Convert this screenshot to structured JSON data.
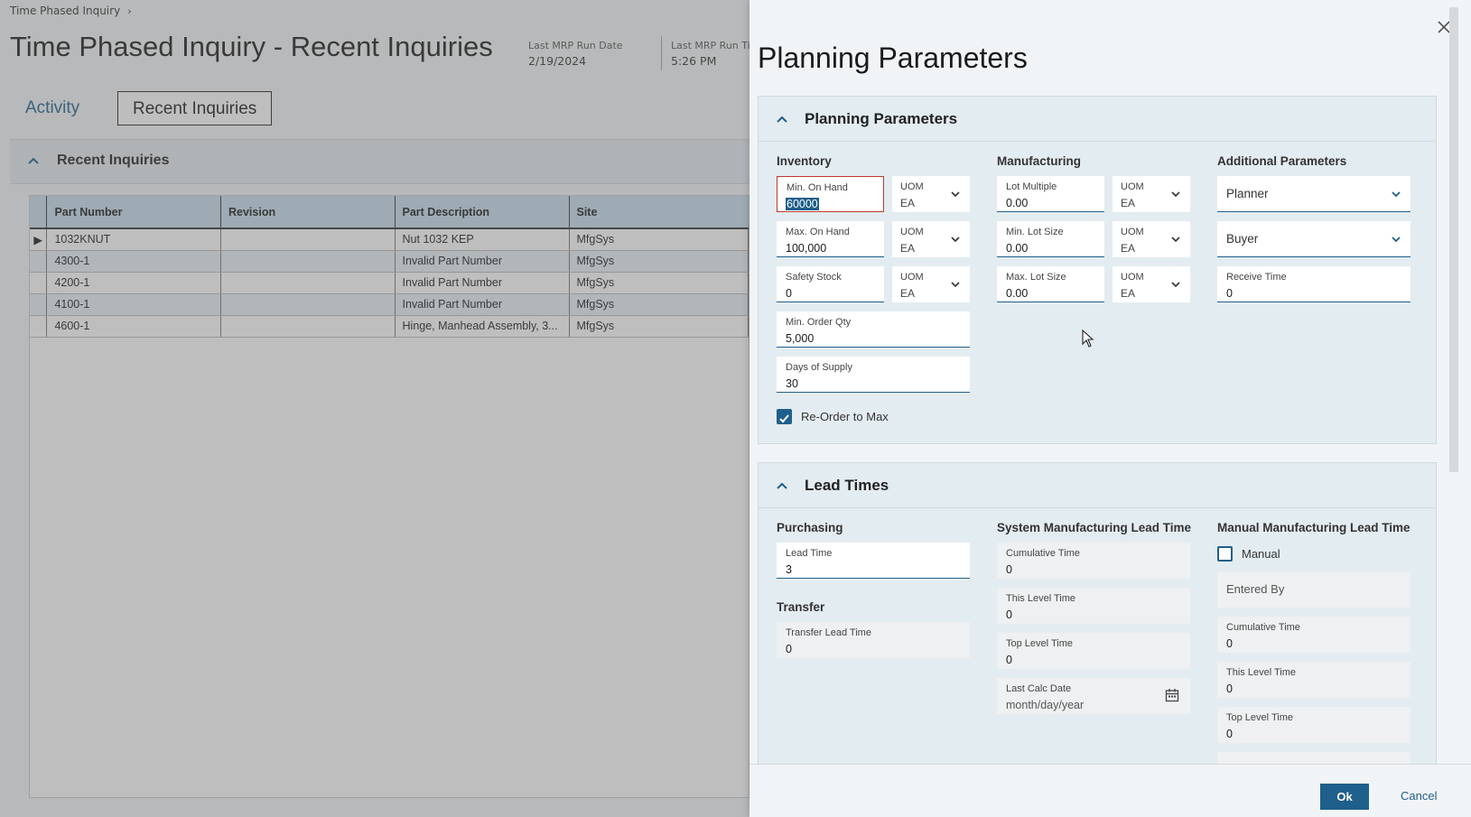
{
  "background": {
    "breadcrumb": "Time Phased Inquiry",
    "title": "Time Phased Inquiry - Recent Inquiries",
    "mrp_run_date_label": "Last MRP Run Date",
    "mrp_run_date": "2/19/2024",
    "mrp_run_time_label": "Last MRP Run Ti",
    "mrp_run_time": "5:26 PM",
    "tabs": [
      "Activity",
      "Recent Inquiries"
    ],
    "section_title": "Recent Inquiries",
    "columns": [
      "Part Number",
      "Revision",
      "Part Description",
      "Site"
    ],
    "rows": [
      {
        "part": "1032KNUT",
        "rev": "",
        "desc": "Nut 1032 KEP",
        "site": "MfgSys"
      },
      {
        "part": "4300-1",
        "rev": "",
        "desc": "Invalid Part Number",
        "site": "MfgSys"
      },
      {
        "part": "4200-1",
        "rev": "",
        "desc": "Invalid Part Number",
        "site": "MfgSys"
      },
      {
        "part": "4100-1",
        "rev": "",
        "desc": "Invalid Part Number",
        "site": "MfgSys"
      },
      {
        "part": "4600-1",
        "rev": "",
        "desc": "Hinge, Manhead Assembly, 3...",
        "site": "MfgSys"
      }
    ]
  },
  "panel": {
    "title": "Planning Parameters",
    "planning": {
      "title": "Planning Parameters",
      "inventory_header": "Inventory",
      "manufacturing_header": "Manufacturing",
      "additional_header": "Additional Parameters",
      "min_on_hand": {
        "label": "Min. On Hand",
        "value": "60000"
      },
      "max_on_hand": {
        "label": "Max. On Hand",
        "value": "100,000"
      },
      "safety_stock": {
        "label": "Safety Stock",
        "value": "0"
      },
      "min_order_qty": {
        "label": "Min. Order Qty",
        "value": "5,000"
      },
      "days_of_supply": {
        "label": "Days of Supply",
        "value": "30"
      },
      "uom_label": "UOM",
      "uom_value": "EA",
      "lot_multiple": {
        "label": "Lot Multiple",
        "value": "0.00"
      },
      "min_lot_size": {
        "label": "Min. Lot Size",
        "value": "0.00"
      },
      "max_lot_size": {
        "label": "Max. Lot Size",
        "value": "0.00"
      },
      "planner": "Planner",
      "buyer": "Buyer",
      "receive_time": {
        "label": "Receive Time",
        "value": "0"
      },
      "reorder_to_max": "Re-Order to Max"
    },
    "lead": {
      "title": "Lead Times",
      "purchasing_header": "Purchasing",
      "transfer_header": "Transfer",
      "system_header": "System Manufacturing Lead Time",
      "manual_header": "Manual Manufacturing Lead Time",
      "lead_time": {
        "label": "Lead Time",
        "value": "3"
      },
      "transfer_lead_time": {
        "label": "Transfer Lead Time",
        "value": "0"
      },
      "sys_cumulative": {
        "label": "Cumulative Time",
        "value": "0"
      },
      "sys_this_level": {
        "label": "This Level Time",
        "value": "0"
      },
      "sys_top_level": {
        "label": "Top Level Time",
        "value": "0"
      },
      "last_calc_date": {
        "label": "Last Calc Date",
        "value": "month/day/year"
      },
      "manual_checkbox": "Manual",
      "entered_by": "Entered By",
      "man_cumulative": {
        "label": "Cumulative Time",
        "value": "0"
      },
      "man_this_level": {
        "label": "This Level Time",
        "value": "0"
      },
      "man_top_level": {
        "label": "Top Level Time",
        "value": "0"
      }
    },
    "ok_label": "Ok",
    "cancel_label": "Cancel"
  }
}
